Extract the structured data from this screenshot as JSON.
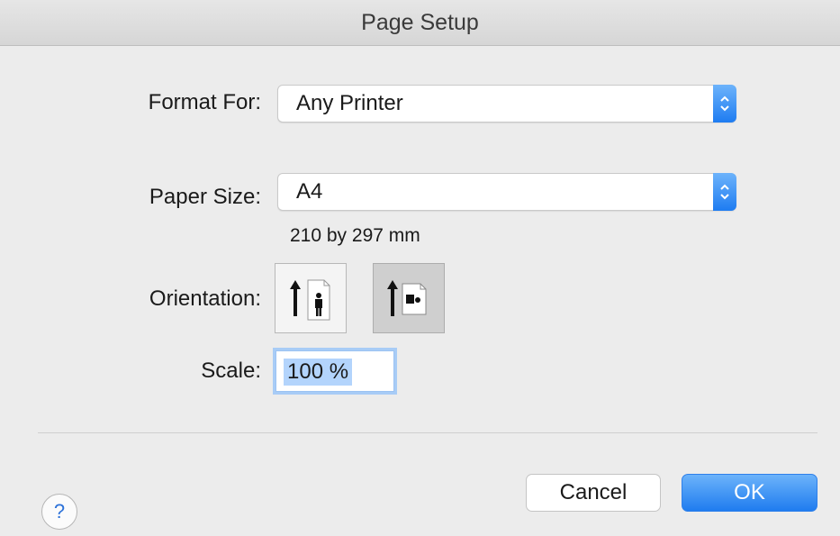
{
  "window": {
    "title": "Page Setup"
  },
  "format_for": {
    "label": "Format For:",
    "value": "Any Printer"
  },
  "paper_size": {
    "label": "Paper Size:",
    "value": "A4",
    "dimensions": "210 by 297 mm"
  },
  "orientation": {
    "label": "Orientation:",
    "options": [
      "portrait",
      "landscape"
    ],
    "selected": "landscape"
  },
  "scale": {
    "label": "Scale:",
    "value": "100 %"
  },
  "buttons": {
    "help": "?",
    "cancel": "Cancel",
    "ok": "OK"
  },
  "colors": {
    "accent": "#1e7cf1",
    "selection": "#b3d4fc"
  }
}
